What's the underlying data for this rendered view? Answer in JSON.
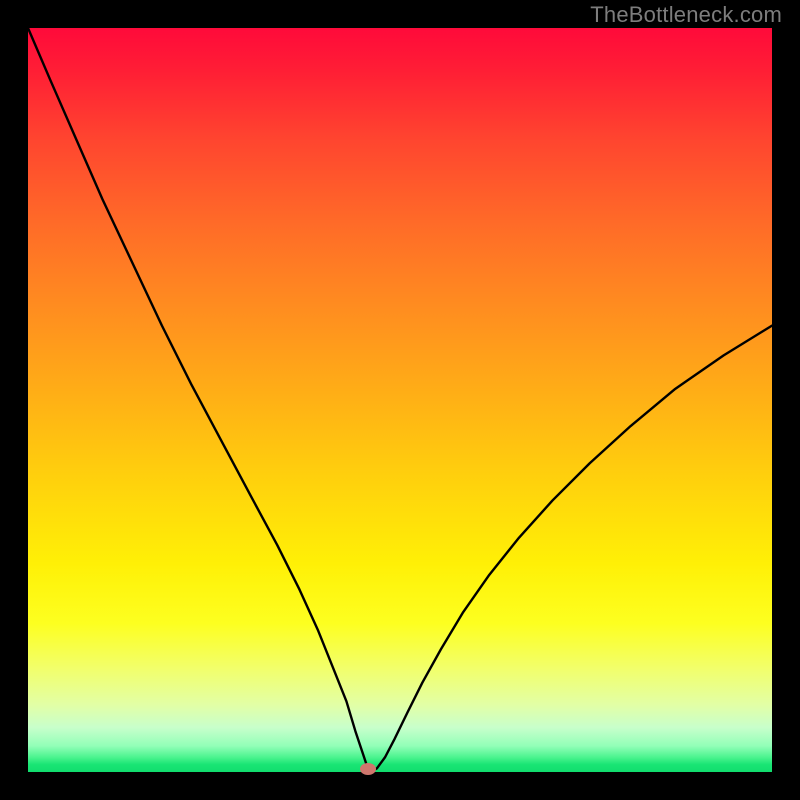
{
  "watermark": "TheBottleneck.com",
  "colors": {
    "frame": "#000000",
    "curve": "#000000",
    "marker": "#cf766d"
  },
  "chart_data": {
    "type": "line",
    "title": "",
    "xlabel": "",
    "ylabel": "",
    "xlim": [
      0,
      100
    ],
    "ylim": [
      0,
      100
    ],
    "background_gradient": "vertical red-yellow-green (bottleneck scale)",
    "minimum": {
      "x": 45.7,
      "y": 0.0
    },
    "series": [
      {
        "name": "bottleneck-curve",
        "x": [
          0.0,
          3.0,
          6.5,
          10.0,
          14.0,
          18.0,
          22.0,
          26.0,
          30.0,
          33.5,
          36.5,
          39.0,
          41.0,
          42.8,
          44.0,
          45.0,
          45.5,
          45.7,
          46.0,
          46.9,
          48.0,
          49.3,
          51.0,
          53.0,
          55.5,
          58.5,
          62.0,
          66.0,
          70.5,
          75.5,
          81.0,
          87.0,
          93.5,
          100.0
        ],
        "y": [
          100.0,
          93.0,
          85.0,
          77.0,
          68.5,
          60.0,
          52.0,
          44.5,
          37.0,
          30.5,
          24.5,
          19.0,
          14.0,
          9.5,
          5.5,
          2.5,
          1.0,
          0.0,
          0.0,
          0.5,
          2.0,
          4.5,
          8.0,
          12.0,
          16.5,
          21.5,
          26.5,
          31.5,
          36.5,
          41.5,
          46.5,
          51.5,
          56.0,
          60.0
        ]
      }
    ]
  }
}
